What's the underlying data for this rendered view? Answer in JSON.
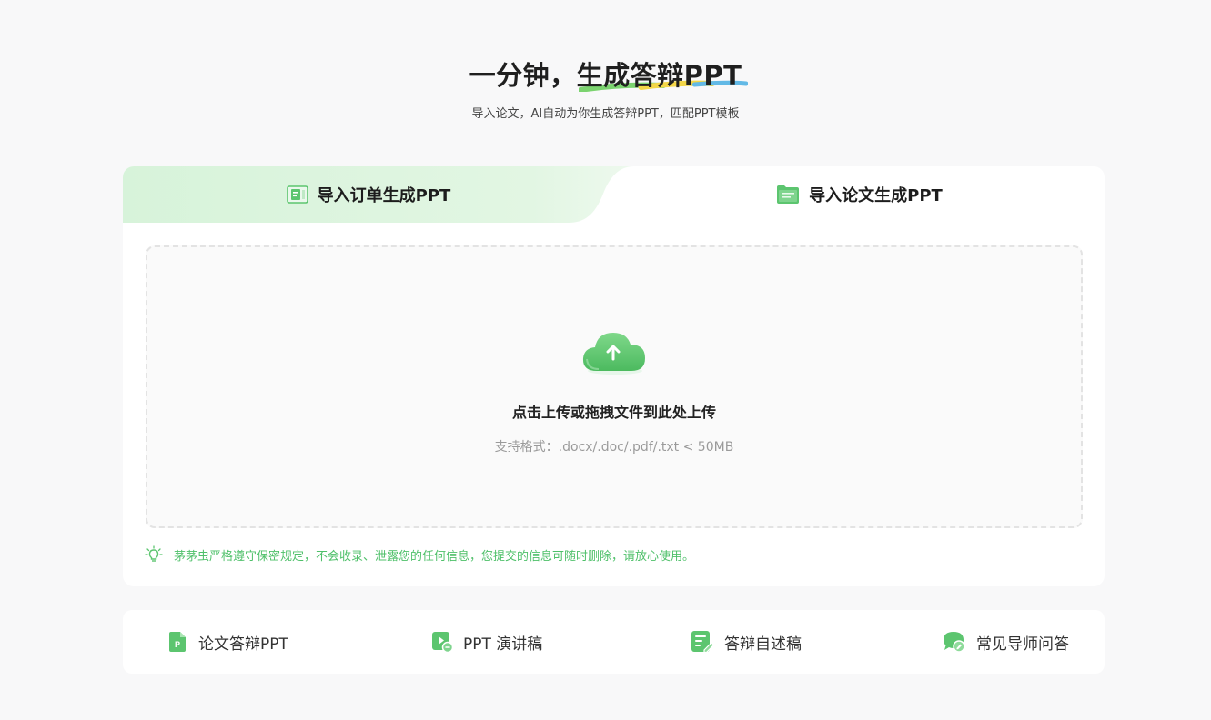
{
  "hero": {
    "title_prefix": "一分钟，",
    "title_highlight": "生成答辩PPT",
    "subtitle": "导入论文，AI自动为你生成答辩PPT，匹配PPT模板"
  },
  "tabs": [
    {
      "label": "导入订单生成PPT",
      "icon": "order-doc-icon",
      "active": true
    },
    {
      "label": "导入论文生成PPT",
      "icon": "folder-icon",
      "active": false
    }
  ],
  "upload": {
    "icon": "cloud-upload-icon",
    "title": "点击上传或拖拽文件到此处上传",
    "hint": "支持格式：.docx/.doc/.pdf/.txt < 50MB"
  },
  "privacy": {
    "icon": "lightbulb-icon",
    "text": "茅茅虫严格遵守保密规定，不会收录、泄露您的任何信息，您提交的信息可随时删除，请放心使用。"
  },
  "features": [
    {
      "label": "论文答辩PPT",
      "icon": "ppt-file-icon"
    },
    {
      "label": "PPT 演讲稿",
      "icon": "speech-play-icon"
    },
    {
      "label": "答辩自述稿",
      "icon": "notes-edit-icon"
    },
    {
      "label": "常见导师问答",
      "icon": "chat-bubble-icon"
    }
  ],
  "colors": {
    "accent": "#5cc56f",
    "tab_active_bg": "#dcf5df",
    "privacy_text": "#4fc06a",
    "underline_green": "#7bd36f",
    "underline_yellow": "#f3d648",
    "underline_blue": "#62b9e6"
  }
}
